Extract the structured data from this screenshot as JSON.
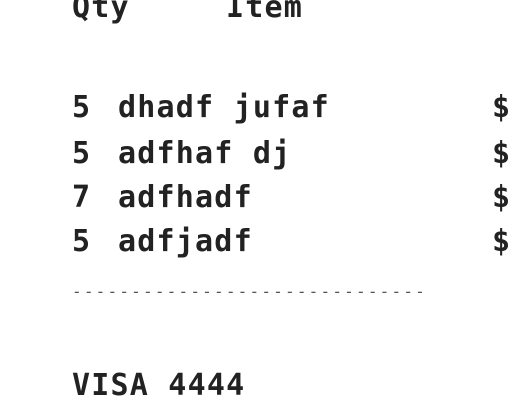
{
  "header": {
    "qty_label": "Qty",
    "item_label": "Item"
  },
  "items": [
    {
      "qty": "5",
      "name": "dhadf jufaf",
      "price": "$"
    },
    {
      "qty": "5",
      "name": "adfhaf dj",
      "price": "$"
    },
    {
      "qty": "7",
      "name": "adfhadf",
      "price": "$"
    },
    {
      "qty": "5",
      "name": "adfjadf",
      "price": "$"
    }
  ],
  "divider": "------------------------------",
  "payment": {
    "method": "VISA 4444"
  }
}
